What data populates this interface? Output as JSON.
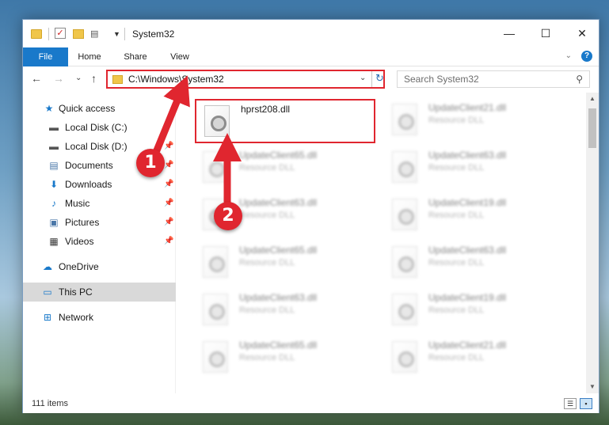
{
  "window": {
    "title": "System32",
    "controls": {
      "minimize": "—",
      "maximize": "☐",
      "close": "✕"
    }
  },
  "ribbon": {
    "tabs": [
      {
        "label": "File"
      },
      {
        "label": "Home"
      },
      {
        "label": "Share"
      },
      {
        "label": "View"
      }
    ],
    "expand_glyph": "⌄",
    "help_glyph": "?"
  },
  "nav": {
    "back": "←",
    "forward": "→",
    "recent": "⌄",
    "up": "↑",
    "address": "C:\\Windows\\System32",
    "address_dropdown": "⌄",
    "refresh": "↻",
    "search_placeholder": "Search System32",
    "search_glyph": "⚲"
  },
  "sidebar": {
    "items": [
      {
        "label": "Quick access",
        "icon": "star-icon",
        "glyph": "★",
        "color": "#1979ca",
        "pinned": false
      },
      {
        "label": "Local Disk (C:)",
        "icon": "drive-windows-icon",
        "glyph": "▬",
        "color": "#555555",
        "pinned": true
      },
      {
        "label": "Local Disk (D:)",
        "icon": "drive-icon",
        "glyph": "▬",
        "color": "#555555",
        "pinned": true
      },
      {
        "label": "Documents",
        "icon": "documents-icon",
        "glyph": "▤",
        "color": "#4a77a8",
        "pinned": true
      },
      {
        "label": "Downloads",
        "icon": "download-icon",
        "glyph": "⬇",
        "color": "#1979ca",
        "pinned": true
      },
      {
        "label": "Music",
        "icon": "music-icon",
        "glyph": "♪",
        "color": "#1979ca",
        "pinned": true
      },
      {
        "label": "Pictures",
        "icon": "pictures-icon",
        "glyph": "▣",
        "color": "#4a77a8",
        "pinned": true
      },
      {
        "label": "Videos",
        "icon": "video-icon",
        "glyph": "▦",
        "color": "#3a3a3a",
        "pinned": true
      },
      {
        "label": "OneDrive",
        "icon": "onedrive-cloud-icon",
        "glyph": "☁",
        "color": "#1979ca",
        "pinned": false
      },
      {
        "label": "This PC",
        "icon": "computer-icon",
        "glyph": "▭",
        "color": "#1979ca",
        "pinned": false
      },
      {
        "label": "Network",
        "icon": "network-icon",
        "glyph": "⊞",
        "color": "#1979ca",
        "pinned": false
      }
    ],
    "pin_glyph": "📌"
  },
  "files": [
    {
      "name": "hprst208.dll",
      "type": ""
    },
    {
      "name": "UpdateClient21.dll",
      "type": "Resource DLL"
    },
    {
      "name": "UpdateClient65.dll",
      "type": "Resource DLL"
    },
    {
      "name": "UpdateClient63.dll",
      "type": "Resource DLL"
    },
    {
      "name": "UpdateClient63.dll",
      "type": "Resource DLL"
    },
    {
      "name": "UpdateClient19.dll",
      "type": "Resource DLL"
    },
    {
      "name": "UpdateClient65.dll",
      "type": "Resource DLL"
    },
    {
      "name": "UpdateClient63.dll",
      "type": "Resource DLL"
    },
    {
      "name": "UpdateClient63.dll",
      "type": "Resource DLL"
    },
    {
      "name": "UpdateClient19.dll",
      "type": "Resource DLL"
    },
    {
      "name": "UpdateClient65.dll",
      "type": "Resource DLL"
    },
    {
      "name": "UpdateClient21.dll",
      "type": "Resource DLL"
    }
  ],
  "status": {
    "item_count": "111 items",
    "details_glyph": "☰",
    "tiles_glyph": "▪"
  },
  "annotations": [
    {
      "label": "1",
      "color": "#e0262f"
    },
    {
      "label": "2",
      "color": "#e0262f"
    }
  ]
}
